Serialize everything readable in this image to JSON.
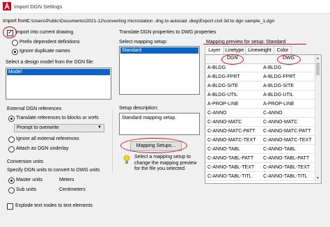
{
  "window": {
    "title": "Import DGN Settings"
  },
  "import_from": {
    "label": "Import from:",
    "path": "C:\\Users\\Public\\Documents\\2021-12\\converting microstation .dng to autocad .dwg\\Export civil 3d to dgn sample_1.dgn"
  },
  "options": {
    "import_into_current": "Import into current drawing",
    "prefix_dependent": "Prefix dependent definitions",
    "ignore_duplicate": "Ignore duplicate names"
  },
  "design_model": {
    "label": "Select a design model from the DGN file:",
    "items": [
      "Model"
    ]
  },
  "external_refs": {
    "label": "External DGN references",
    "translate": "Translate references to blocks or xrefs",
    "prompt_value": "Prompt to overwrite",
    "ignore_all": "Ignore all external references",
    "attach_underlay": "Attach as DGN underlay"
  },
  "conversion_units": {
    "label": "Conversion units",
    "specify": "Specify DGN units to convert to DWG units",
    "master": "Master units",
    "sub": "Sub units",
    "meters": "Meters",
    "centimeters": "Centimeters"
  },
  "explode_text": "Explode text nodes to text elements",
  "translate_props": {
    "label": "Translate DGN properties to DWG properties"
  },
  "mapping_setup": {
    "label": "Select mapping setup:",
    "items": [
      "Standard"
    ]
  },
  "setup_description": {
    "label": "Setup description:",
    "text": "Standard mapping setup."
  },
  "mapping_button": "Mapping Setups...",
  "info_text": "Select a mapping setup to change the mapping preview for the file you selected.",
  "preview": {
    "label": "Mapping preview for setup: Standard",
    "tabs": [
      "Layer",
      "Linetype",
      "Lineweight",
      "Color"
    ],
    "columns": [
      "DGN",
      "DWG"
    ],
    "rows": [
      [
        "A-BLDG",
        "A-BLDG"
      ],
      [
        "A-BLDG-FPRT",
        "A-BLDG-FPRT"
      ],
      [
        "A-BLDG-SITE",
        "A-BLDG-SITE"
      ],
      [
        "A-BLDG-UTIL",
        "A-BLDG-UTIL"
      ],
      [
        "A-PROP-LINE",
        "A-PROP-LINE"
      ],
      [
        "C-ANNO",
        "C-ANNO"
      ],
      [
        "C-ANNO-MATC",
        "C-ANNO-MATC"
      ],
      [
        "C-ANNO-MATC-PATT",
        "C-ANNO-MATC-PATT"
      ],
      [
        "C-ANNO-MATC-TEXT",
        "C-ANNO-MATC-TEXT"
      ],
      [
        "C-ANNO-TABL",
        "C-ANNO-TABL"
      ],
      [
        "C-ANNO-TABL-PATT",
        "C-ANNO-TABL-PATT"
      ],
      [
        "C-ANNO-TABL-TEXT",
        "C-ANNO-TABL-TEXT"
      ],
      [
        "C-ANNO-TABL-TITL",
        "C-ANNO-TABL-TITL"
      ]
    ]
  },
  "colors": {
    "selection": "#0a64c8",
    "annotation": "#c8102e",
    "brand": "#d6001c"
  },
  "icons": {
    "app": "autocad-logo-icon",
    "info": "lightbulb-icon",
    "dropdown": "chevron-down-icon"
  }
}
